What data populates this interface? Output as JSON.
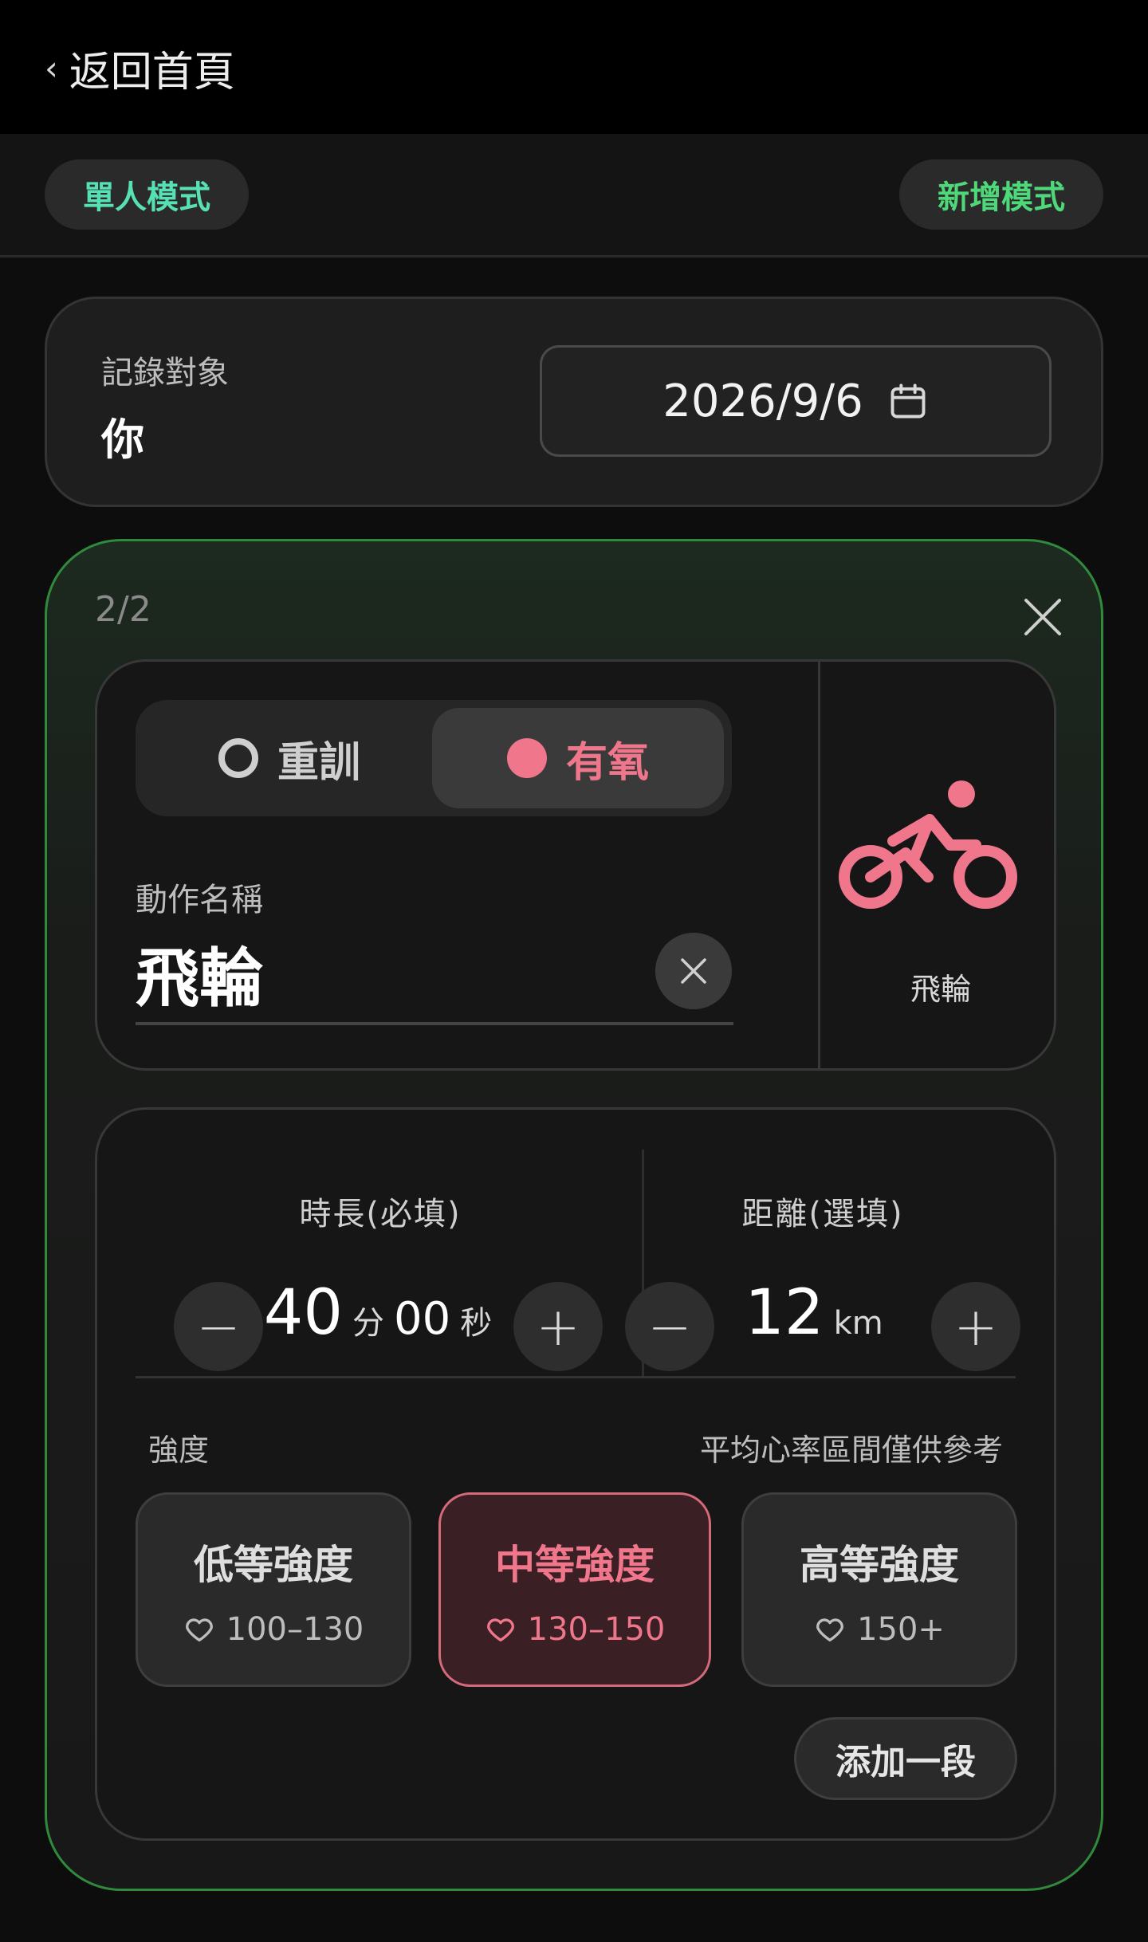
{
  "nav": {
    "back_chevron": "‹",
    "back_label": "返回首頁"
  },
  "modes": {
    "single": "單人模式",
    "add": "新增模式"
  },
  "record": {
    "label": "記錄對象",
    "value": "你",
    "date": "2026/9/6",
    "date_icon": "calendar-icon"
  },
  "exercise": {
    "counter": "2/2",
    "type_options": [
      {
        "label": "重訓",
        "selected": false
      },
      {
        "label": "有氧",
        "selected": true
      }
    ],
    "name_label": "動作名稱",
    "name_value": "飛輪",
    "icon_name": "cycling-icon",
    "icon_label": "飛輪",
    "accent": "#f0778b"
  },
  "metrics": {
    "duration": {
      "title": "時長(必填)",
      "minutes": "40",
      "minutes_unit": "分",
      "seconds": "00",
      "seconds_unit": "秒",
      "minus": "−",
      "plus": "+"
    },
    "distance": {
      "title": "距離(選填)",
      "value": "12",
      "unit": "km",
      "minus": "−",
      "plus": "+"
    }
  },
  "intensity": {
    "label": "強度",
    "note": "平均心率區間僅供參考",
    "options": [
      {
        "title": "低等強度",
        "range": "100–130",
        "selected": false
      },
      {
        "title": "中等強度",
        "range": "130–150",
        "selected": true
      },
      {
        "title": "高等強度",
        "range": "150+",
        "selected": false
      }
    ],
    "add_segment": "添加一段"
  }
}
